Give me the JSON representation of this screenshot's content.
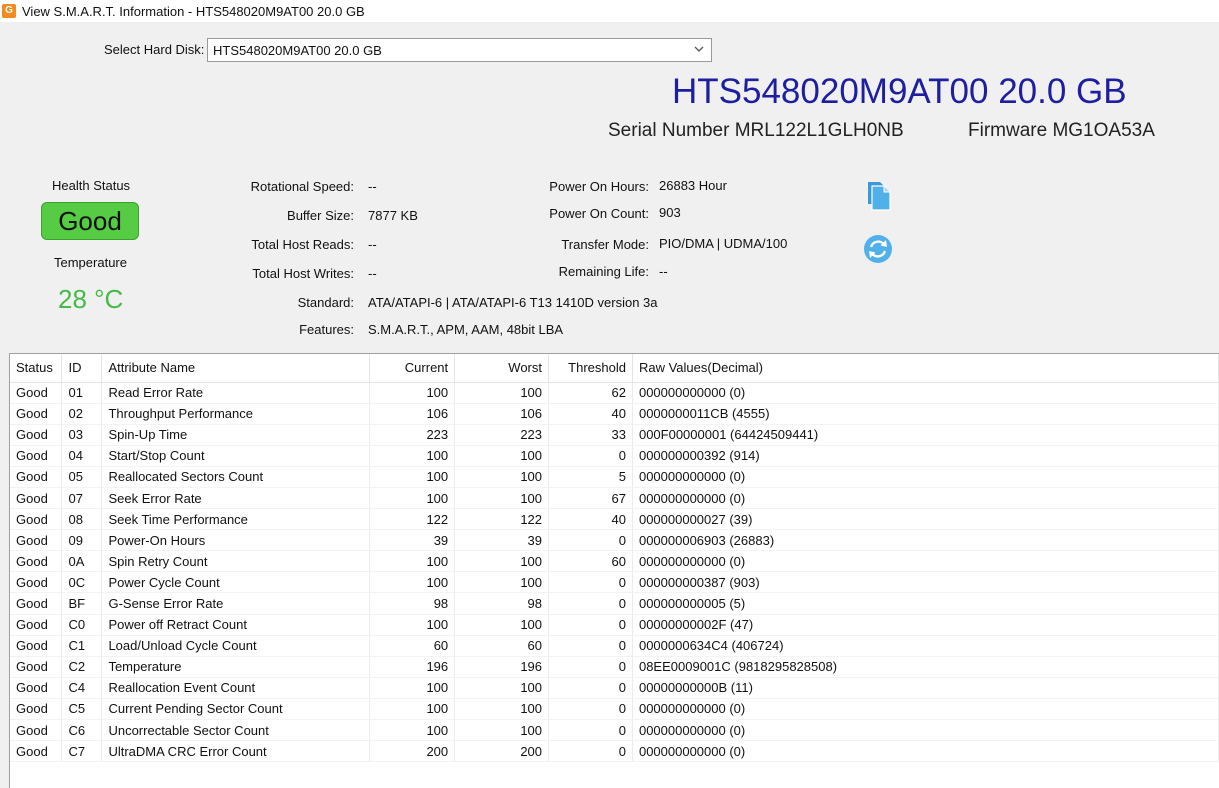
{
  "window": {
    "title": "View S.M.A.R.T. Information - HTS548020M9AT00 20.0 GB"
  },
  "disk_select": {
    "label": "Select Hard Disk:",
    "selected": "HTS548020M9AT00 20.0 GB"
  },
  "header": {
    "model": "HTS548020M9AT00 20.0 GB",
    "serial": "Serial Number MRL122L1GLH0NB",
    "firmware": "Firmware MG1OA53A"
  },
  "health": {
    "label": "Health Status",
    "value": "Good",
    "temperature_label": "Temperature",
    "temperature_value": "28 °C"
  },
  "info": {
    "rotational_speed": {
      "label": "Rotational Speed:",
      "value": "--"
    },
    "buffer_size": {
      "label": "Buffer Size:",
      "value": "7877 KB"
    },
    "total_host_reads": {
      "label": "Total Host Reads:",
      "value": "--"
    },
    "total_host_writes": {
      "label": "Total Host Writes:",
      "value": "--"
    },
    "standard": {
      "label": "Standard:",
      "value": "ATA/ATAPI-6 | ATA/ATAPI-6 T13 1410D version 3a"
    },
    "features": {
      "label": "Features:",
      "value": "S.M.A.R.T., APM, AAM, 48bit LBA"
    },
    "power_on_hours": {
      "label": "Power On Hours:",
      "value": "26883 Hour"
    },
    "power_on_count": {
      "label": "Power On Count:",
      "value": "903"
    },
    "transfer_mode": {
      "label": "Transfer Mode:",
      "value": "PIO/DMA | UDMA/100"
    },
    "remaining_life": {
      "label": "Remaining Life:",
      "value": "--"
    }
  },
  "icons": {
    "copy": "copy-icon",
    "refresh": "refresh-icon",
    "accent": "#3a9ad9"
  },
  "table": {
    "columns": [
      "Status",
      "ID",
      "Attribute Name",
      "Current",
      "Worst",
      "Threshold",
      "Raw Values(Decimal)"
    ],
    "rows": [
      [
        "Good",
        "01",
        "Read Error Rate",
        "100",
        "100",
        "62",
        "000000000000 (0)"
      ],
      [
        "Good",
        "02",
        "Throughput Performance",
        "106",
        "106",
        "40",
        "0000000011CB (4555)"
      ],
      [
        "Good",
        "03",
        "Spin-Up Time",
        "223",
        "223",
        "33",
        "000F00000001 (64424509441)"
      ],
      [
        "Good",
        "04",
        "Start/Stop Count",
        "100",
        "100",
        "0",
        "000000000392 (914)"
      ],
      [
        "Good",
        "05",
        "Reallocated Sectors Count",
        "100",
        "100",
        "5",
        "000000000000 (0)"
      ],
      [
        "Good",
        "07",
        "Seek Error Rate",
        "100",
        "100",
        "67",
        "000000000000 (0)"
      ],
      [
        "Good",
        "08",
        "Seek Time Performance",
        "122",
        "122",
        "40",
        "000000000027 (39)"
      ],
      [
        "Good",
        "09",
        "Power-On Hours",
        "39",
        "39",
        "0",
        "000000006903 (26883)"
      ],
      [
        "Good",
        "0A",
        "Spin Retry Count",
        "100",
        "100",
        "60",
        "000000000000 (0)"
      ],
      [
        "Good",
        "0C",
        "Power Cycle Count",
        "100",
        "100",
        "0",
        "000000000387 (903)"
      ],
      [
        "Good",
        "BF",
        "G-Sense Error Rate",
        "98",
        "98",
        "0",
        "000000000005 (5)"
      ],
      [
        "Good",
        "C0",
        "Power off Retract Count",
        "100",
        "100",
        "0",
        "00000000002F (47)"
      ],
      [
        "Good",
        "C1",
        "Load/Unload Cycle Count",
        "60",
        "60",
        "0",
        "0000000634C4 (406724)"
      ],
      [
        "Good",
        "C2",
        "Temperature",
        "196",
        "196",
        "0",
        "08EE0009001C (9818295828508)"
      ],
      [
        "Good",
        "C4",
        "Reallocation Event Count",
        "100",
        "100",
        "0",
        "00000000000B (11)"
      ],
      [
        "Good",
        "C5",
        "Current Pending Sector Count",
        "100",
        "100",
        "0",
        "000000000000 (0)"
      ],
      [
        "Good",
        "C6",
        "Uncorrectable Sector Count",
        "100",
        "100",
        "0",
        "000000000000 (0)"
      ],
      [
        "Good",
        "C7",
        "UltraDMA CRC Error Count",
        "200",
        "200",
        "0",
        "000000000000 (0)"
      ]
    ]
  }
}
